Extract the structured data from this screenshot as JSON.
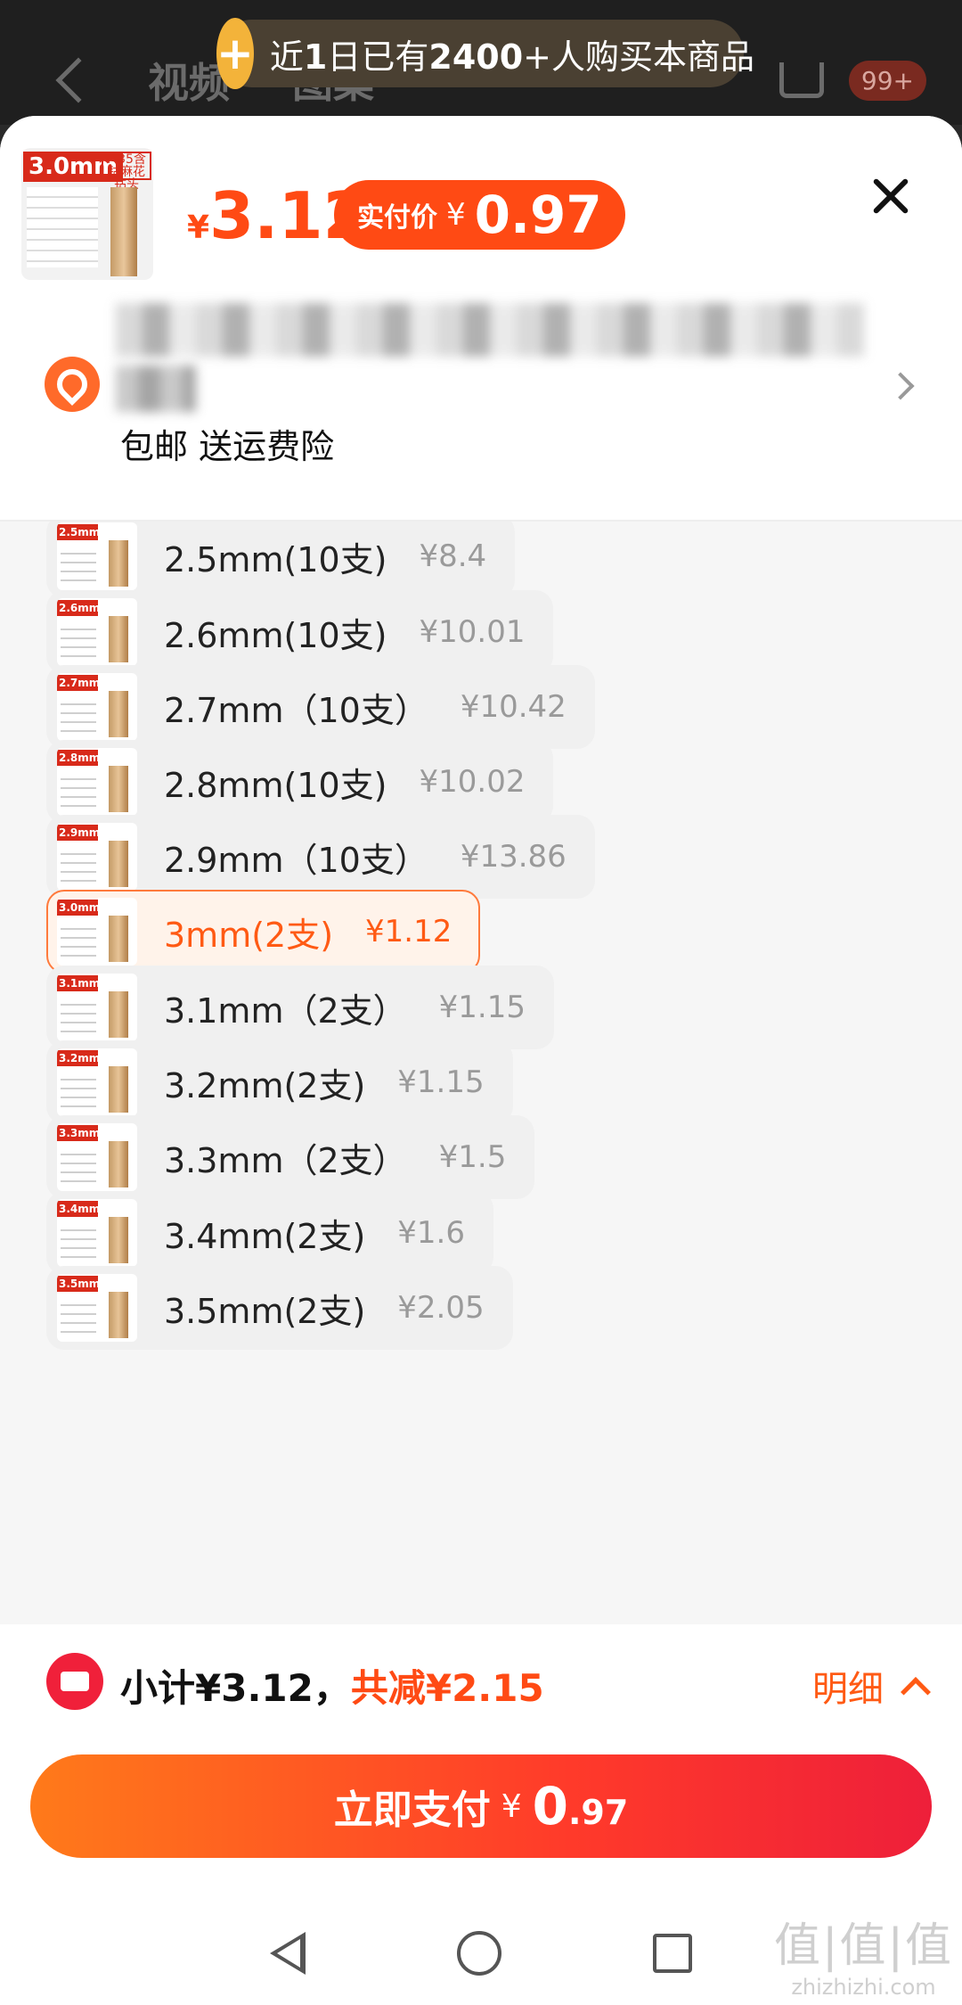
{
  "background": {
    "tabs": [
      "视频",
      "图集"
    ],
    "cart_badge": "99+"
  },
  "banner": {
    "prefix": "近",
    "days": "1",
    "mid": "日已有",
    "count": "2400",
    "suffix": "+人购买本商品"
  },
  "header": {
    "thumb_tag": "3.0mm",
    "thumb_tag2": "M35含钴麻花钻头",
    "price_symbol": "¥",
    "price": "3.12",
    "paid_label": "实付价",
    "paid_symbol": "¥",
    "paid_price": "0.97",
    "shipping_text": "包邮 送运费险"
  },
  "options": [
    {
      "thumb": "2.5mm",
      "label": "2.5mm(10支)",
      "price": "¥8.4",
      "selected": false
    },
    {
      "thumb": "2.6mm",
      "label": "2.6mm(10支)",
      "price": "¥10.01",
      "selected": false
    },
    {
      "thumb": "2.7mm",
      "label": "2.7mm（10支）",
      "price": "¥10.42",
      "selected": false
    },
    {
      "thumb": "2.8mm",
      "label": "2.8mm(10支)",
      "price": "¥10.02",
      "selected": false
    },
    {
      "thumb": "2.9mm",
      "label": "2.9mm（10支）",
      "price": "¥13.86",
      "selected": false
    },
    {
      "thumb": "3.0mm",
      "label": "3mm(2支)",
      "price": "¥1.12",
      "selected": true
    },
    {
      "thumb": "3.1mm",
      "label": "3.1mm（2支）",
      "price": "¥1.15",
      "selected": false
    },
    {
      "thumb": "3.2mm",
      "label": "3.2mm(2支)",
      "price": "¥1.15",
      "selected": false
    },
    {
      "thumb": "3.3mm",
      "label": "3.3mm（2支）",
      "price": "¥1.5",
      "selected": false
    },
    {
      "thumb": "3.4mm",
      "label": "3.4mm(2支)",
      "price": "¥1.6",
      "selected": false
    },
    {
      "thumb": "3.5mm",
      "label": "3.5mm(2支)",
      "price": "¥2.05",
      "selected": false
    }
  ],
  "footer": {
    "subtotal": "小计¥3.12，",
    "saved": "共减¥2.15",
    "detail": "明细",
    "pay_label": "立即支付",
    "pay_symbol": "¥",
    "pay_int": "0",
    "pay_dec": ".97"
  },
  "watermark": {
    "big": "值|值|值",
    "small": "zhizhizhi.com"
  }
}
